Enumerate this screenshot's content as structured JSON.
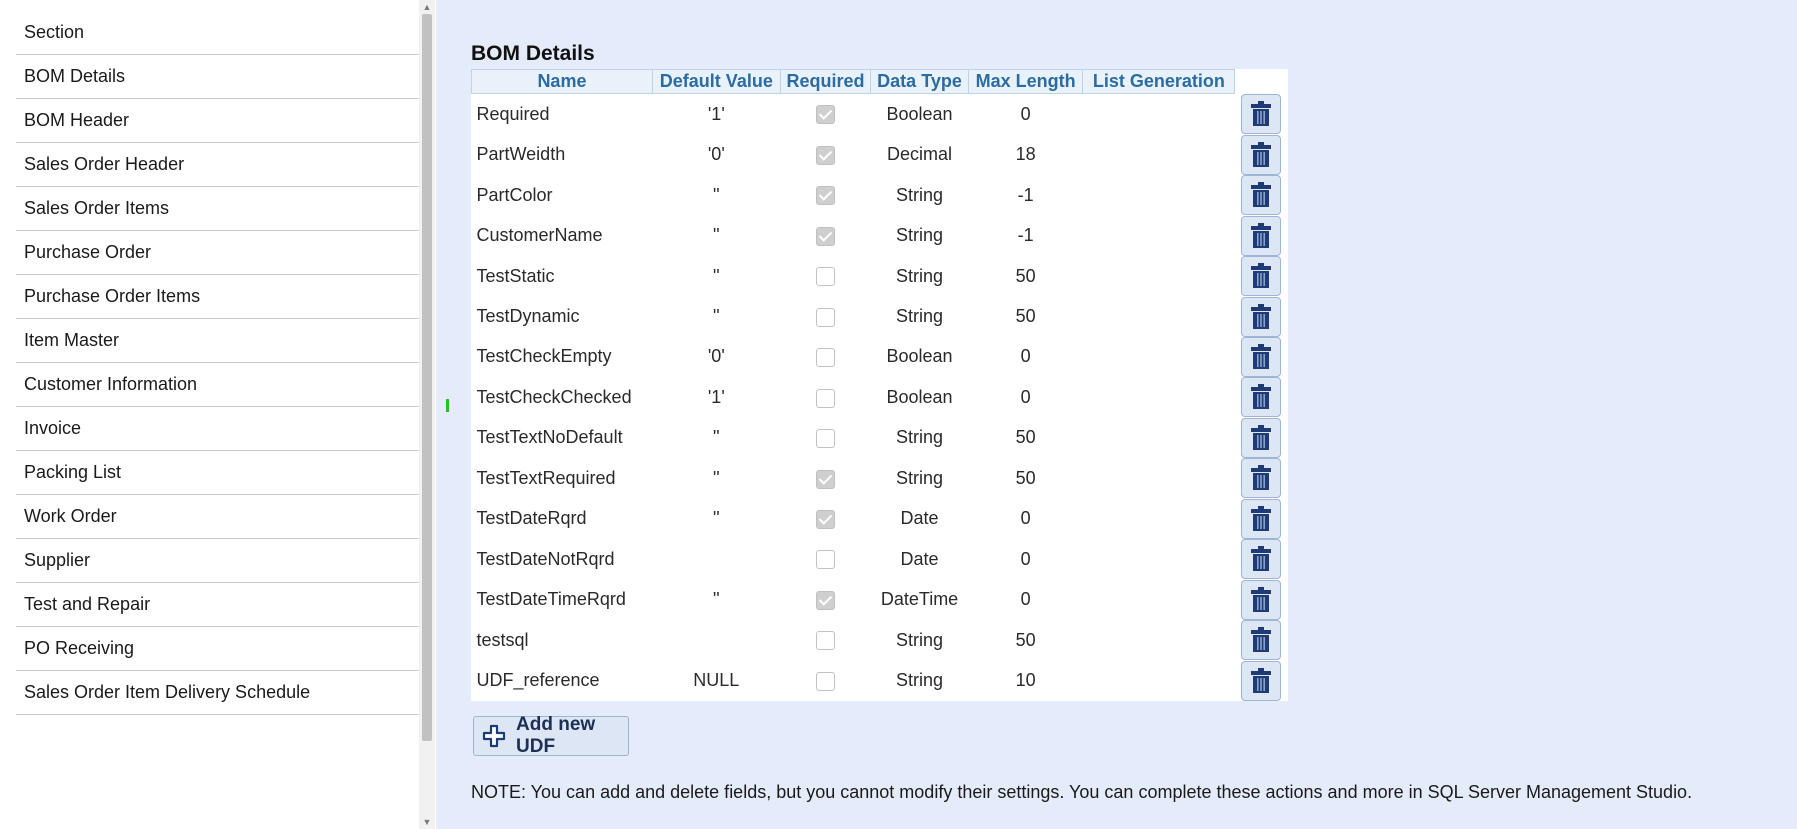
{
  "sidebar": {
    "items": [
      {
        "label": "Section"
      },
      {
        "label": "BOM Details"
      },
      {
        "label": "BOM Header"
      },
      {
        "label": "Sales Order Header"
      },
      {
        "label": "Sales Order Items"
      },
      {
        "label": "Purchase Order"
      },
      {
        "label": "Purchase Order Items"
      },
      {
        "label": "Item Master"
      },
      {
        "label": "Customer Information"
      },
      {
        "label": "Invoice"
      },
      {
        "label": "Packing List"
      },
      {
        "label": "Work Order"
      },
      {
        "label": "Supplier"
      },
      {
        "label": "Test and Repair"
      },
      {
        "label": "PO Receiving"
      },
      {
        "label": "Sales Order Item Delivery Schedule"
      }
    ]
  },
  "main": {
    "title": "BOM Details",
    "columns": [
      "Name",
      "Default Value",
      "Required",
      "Data Type",
      "Max Length",
      "List Generation"
    ],
    "rows": [
      {
        "name": "Required",
        "default": "'1'",
        "required": true,
        "type": "Boolean",
        "max": "0",
        "list": ""
      },
      {
        "name": "PartWeidth",
        "default": "'0'",
        "required": true,
        "type": "Decimal",
        "max": "18",
        "list": ""
      },
      {
        "name": "PartColor",
        "default": "''",
        "required": true,
        "type": "String",
        "max": "-1",
        "list": ""
      },
      {
        "name": "CustomerName",
        "default": "''",
        "required": true,
        "type": "String",
        "max": "-1",
        "list": ""
      },
      {
        "name": "TestStatic",
        "default": "''",
        "required": false,
        "type": "String",
        "max": "50",
        "list": ""
      },
      {
        "name": "TestDynamic",
        "default": "''",
        "required": false,
        "type": "String",
        "max": "50",
        "list": ""
      },
      {
        "name": "TestCheckEmpty",
        "default": "'0'",
        "required": false,
        "type": "Boolean",
        "max": "0",
        "list": ""
      },
      {
        "name": "TestCheckChecked",
        "default": "'1'",
        "required": false,
        "type": "Boolean",
        "max": "0",
        "list": ""
      },
      {
        "name": "TestTextNoDefault",
        "default": "''",
        "required": false,
        "type": "String",
        "max": "50",
        "list": ""
      },
      {
        "name": "TestTextRequired",
        "default": "''",
        "required": true,
        "type": "String",
        "max": "50",
        "list": ""
      },
      {
        "name": "TestDateRqrd",
        "default": "''",
        "required": true,
        "type": "Date",
        "max": "0",
        "list": ""
      },
      {
        "name": "TestDateNotRqrd",
        "default": "",
        "required": false,
        "type": "Date",
        "max": "0",
        "list": ""
      },
      {
        "name": "TestDateTimeRqrd",
        "default": "''",
        "required": true,
        "type": "DateTime",
        "max": "0",
        "list": ""
      },
      {
        "name": "testsql",
        "default": "",
        "required": false,
        "type": "String",
        "max": "50",
        "list": ""
      },
      {
        "name": "UDF_reference",
        "default": "NULL",
        "required": false,
        "type": "String",
        "max": "10",
        "list": ""
      }
    ],
    "add_button_label": "Add new UDF",
    "note": "NOTE: You can add and delete fields, but you cannot modify their settings. You can complete these actions and more in SQL Server Management Studio."
  },
  "icons": {
    "delete": "trash-icon",
    "add": "plus-icon"
  },
  "colors": {
    "panel_background": "#e4ebfa",
    "header_text": "#2b6ca3",
    "button_icon": "#1f3b75"
  }
}
